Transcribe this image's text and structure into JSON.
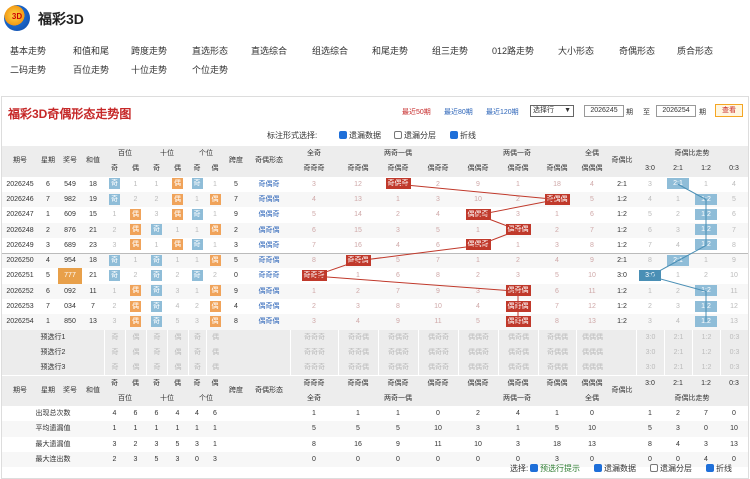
{
  "app": {
    "title": "福彩3D",
    "logo_text": "3D"
  },
  "nav": {
    "row1": [
      "基本走势",
      "和值和尾",
      "跨度走势",
      "直选形态",
      "直选综合",
      "组选综合",
      "和尾走势",
      "组三走势",
      "012路走势",
      "大小形态",
      "奇偶形态",
      "质合形态"
    ],
    "row2": [
      "二码走势",
      "百位走势",
      "十位走势",
      "个位走势"
    ]
  },
  "panel": {
    "title": "福彩3D奇偶形态走势图",
    "recent": [
      "最近50期",
      "最近80期",
      "最近120期"
    ],
    "select": "选择行",
    "from": "2026245",
    "to": "2026254",
    "qi": "期",
    "zhi": "至",
    "check": "查看",
    "options_label": "标注形式选择:",
    "options": [
      "遗漏数据",
      "遗漏分层",
      "折线"
    ]
  },
  "header": {
    "row1": [
      "期号",
      "星期",
      "奖号",
      "和值",
      "百位",
      "十位",
      "个位",
      "跨度",
      "奇偶形态",
      "全奇",
      "两奇一偶",
      "两偶一奇",
      "全偶",
      "奇偶比",
      "奇偶比走势"
    ],
    "row2": [
      "奇",
      "偶",
      "奇",
      "偶",
      "奇",
      "偶",
      "奇奇奇",
      "奇奇偶",
      "奇偶奇",
      "偶奇奇",
      "偶偶奇",
      "偶奇偶",
      "奇偶偶",
      "偶偶偶",
      "3:0",
      "2:1",
      "1:2",
      "0:3"
    ]
  },
  "rows": [
    {
      "qh": "2026245",
      "xq": "6",
      "jh": "549",
      "hz": "18",
      "b": [
        "奇",
        "1"
      ],
      "s": [
        "1",
        "偶"
      ],
      "g": [
        "奇",
        "1"
      ],
      "kd": "5",
      "xt": "奇偶奇",
      "qj": "3",
      "ljy": [
        "12",
        "奇偶奇",
        "2"
      ],
      "loy": [
        "9",
        "1",
        "18"
      ],
      "qo": "4",
      "bi": "2:1",
      "zs": [
        "3",
        "2:1",
        "1",
        "4"
      ]
    },
    {
      "qh": "2026246",
      "xq": "7",
      "jh": "982",
      "hz": "19",
      "b": [
        "奇",
        "2"
      ],
      "s": [
        "2",
        "偶"
      ],
      "g": [
        "1",
        "偶"
      ],
      "kd": "7",
      "xt": "奇偶偶",
      "qj": "4",
      "ljy": [
        "13",
        "1",
        "3"
      ],
      "loy": [
        "10",
        "2",
        "奇偶偶"
      ],
      "qo": "5",
      "bi": "1:2",
      "zs": [
        "4",
        "1",
        "1:2",
        "5"
      ]
    },
    {
      "qh": "2026247",
      "xq": "1",
      "jh": "609",
      "hz": "15",
      "b": [
        "1",
        "偶"
      ],
      "s": [
        "3",
        "偶"
      ],
      "g": [
        "奇",
        "1"
      ],
      "kd": "9",
      "xt": "偶偶奇",
      "qj": "5",
      "ljy": [
        "14",
        "2",
        "4"
      ],
      "loy": [
        "偶偶奇",
        "3",
        "1"
      ],
      "qo": "6",
      "bi": "1:2",
      "zs": [
        "5",
        "2",
        "1:2",
        "6"
      ]
    },
    {
      "qh": "2026248",
      "xq": "2",
      "jh": "876",
      "hz": "21",
      "b": [
        "2",
        "偶"
      ],
      "s": [
        "奇",
        "1"
      ],
      "g": [
        "1",
        "偶"
      ],
      "kd": "2",
      "xt": "偶奇偶",
      "qj": "6",
      "ljy": [
        "15",
        "3",
        "5"
      ],
      "loy": [
        "1",
        "偶奇偶",
        "2"
      ],
      "qo": "7",
      "bi": "1:2",
      "zs": [
        "6",
        "3",
        "1:2",
        "7"
      ]
    },
    {
      "qh": "2026249",
      "xq": "3",
      "jh": "689",
      "hz": "23",
      "b": [
        "3",
        "偶"
      ],
      "s": [
        "1",
        "偶"
      ],
      "g": [
        "奇",
        "1"
      ],
      "kd": "3",
      "xt": "偶偶奇",
      "qj": "7",
      "ljy": [
        "16",
        "4",
        "6"
      ],
      "loy": [
        "偶偶奇",
        "1",
        "3"
      ],
      "qo": "8",
      "bi": "1:2",
      "zs": [
        "7",
        "4",
        "1:2",
        "8"
      ]
    },
    {
      "qh": "2026250",
      "xq": "4",
      "jh": "954",
      "hz": "18",
      "b": [
        "奇",
        "1"
      ],
      "s": [
        "奇",
        "1"
      ],
      "g": [
        "1",
        "偶"
      ],
      "kd": "5",
      "xt": "奇奇偶",
      "qj": "8",
      "ljy": [
        "奇奇偶",
        "5",
        "7"
      ],
      "loy": [
        "1",
        "2",
        "4"
      ],
      "qo": "9",
      "bi": "2:1",
      "zs": [
        "8",
        "2:1",
        "1",
        "9"
      ]
    },
    {
      "qh": "2026251",
      "xq": "5",
      "jh": "777",
      "hz": "21",
      "b": [
        "奇",
        "2"
      ],
      "s": [
        "奇",
        "2"
      ],
      "g": [
        "奇",
        "2"
      ],
      "kd": "0",
      "xt": "奇奇奇",
      "qj": "奇奇奇",
      "ljy": [
        "1",
        "6",
        "8"
      ],
      "loy": [
        "2",
        "3",
        "5"
      ],
      "qo": "10",
      "bi": "3:0",
      "zs": [
        "3:0",
        "1",
        "2",
        "10"
      ]
    },
    {
      "qh": "2026252",
      "xq": "6",
      "jh": "092",
      "hz": "11",
      "b": [
        "1",
        "偶"
      ],
      "s": [
        "奇",
        "3"
      ],
      "g": [
        "1",
        "偶"
      ],
      "kd": "9",
      "xt": "偶奇偶",
      "qj": "1",
      "ljy": [
        "2",
        "7",
        "9"
      ],
      "loy": [
        "3",
        "偶奇偶",
        "6"
      ],
      "qo": "11",
      "bi": "1:2",
      "zs": [
        "1",
        "2",
        "1:2",
        "11"
      ]
    },
    {
      "qh": "2026253",
      "xq": "7",
      "jh": "034",
      "hz": "7",
      "b": [
        "2",
        "偶"
      ],
      "s": [
        "奇",
        "4"
      ],
      "g": [
        "2",
        "偶"
      ],
      "kd": "4",
      "xt": "偶奇偶",
      "qj": "2",
      "ljy": [
        "3",
        "8",
        "10"
      ],
      "loy": [
        "4",
        "偶奇偶",
        "7"
      ],
      "qo": "12",
      "bi": "1:2",
      "zs": [
        "2",
        "3",
        "1:2",
        "12"
      ]
    },
    {
      "qh": "2026254",
      "xq": "1",
      "jh": "850",
      "hz": "13",
      "b": [
        "3",
        "偶"
      ],
      "s": [
        "奇",
        "5"
      ],
      "g": [
        "3",
        "偶"
      ],
      "kd": "8",
      "xt": "偶奇偶",
      "qj": "3",
      "ljy": [
        "4",
        "9",
        "11"
      ],
      "loy": [
        "5",
        "偶奇偶",
        "8"
      ],
      "qo": "13",
      "bi": "1:2",
      "zs": [
        "3",
        "4",
        "1:2",
        "13"
      ]
    }
  ],
  "preview": {
    "labels": [
      "预选行1",
      "预选行2",
      "预选行3"
    ],
    "cells": [
      "奇",
      "偶",
      "奇",
      "偶",
      "奇",
      "偶",
      "奇奇奇",
      "奇奇偶",
      "奇偶奇",
      "偶奇奇",
      "偶偶奇",
      "偶奇偶",
      "奇偶偶",
      "偶偶偶",
      "3:0",
      "2:1",
      "1:2",
      "0:3"
    ]
  },
  "stats": {
    "labels": [
      "出现总次数",
      "平均遗漏值",
      "最大遗漏值",
      "最大连出数"
    ],
    "rows": [
      [
        "4",
        "6",
        "6",
        "4",
        "4",
        "6",
        "1",
        "1",
        "1",
        "0",
        "2",
        "4",
        "1",
        "0",
        "1",
        "2",
        "7",
        "0"
      ],
      [
        "1",
        "1",
        "1",
        "1",
        "1",
        "1",
        "5",
        "5",
        "5",
        "10",
        "3",
        "1",
        "5",
        "10",
        "5",
        "3",
        "0",
        "10"
      ],
      [
        "3",
        "2",
        "3",
        "5",
        "3",
        "1",
        "8",
        "16",
        "9",
        "11",
        "10",
        "3",
        "18",
        "13",
        "8",
        "4",
        "3",
        "13"
      ],
      [
        "2",
        "3",
        "5",
        "3",
        "0",
        "3",
        "0",
        "0",
        "0",
        "0",
        "0",
        "0",
        "3",
        "0",
        "0",
        "0",
        "4",
        "0"
      ]
    ]
  },
  "footer": {
    "label": "选择:",
    "items": [
      "预选行提示",
      "遗漏数据",
      "遗漏分层",
      "折线"
    ]
  }
}
